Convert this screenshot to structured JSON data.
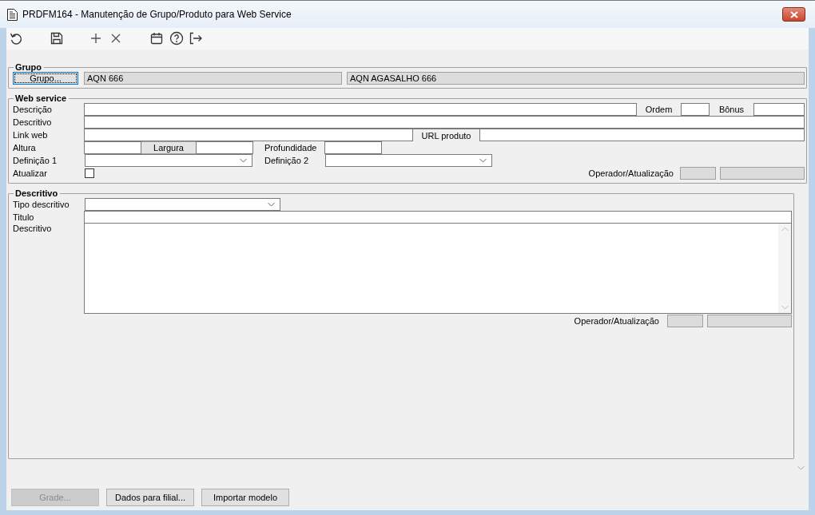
{
  "window": {
    "title": "PRDFM164 - Manutenção de Grupo/Produto para Web Service"
  },
  "grupo": {
    "title": "Grupo",
    "button": "Grupo...",
    "code": "AQN 666",
    "name": "AQN AGASALHO 666"
  },
  "web_service": {
    "title": "Web service",
    "descricao_label": "Descrição",
    "ordem_label": "Ordem",
    "bonus_label": "Bônus",
    "descritivo_label": "Descritivo",
    "link_web_label": "Link web",
    "url_produto_label": "URL produto",
    "altura_label": "Altura",
    "largura_label": "Largura",
    "profundidade_label": "Profundidade",
    "definicao1_label": "Definição 1",
    "definicao2_label": "Definição 2",
    "atualizar_label": "Atualizar",
    "atualizar_checked": false,
    "operador_label": "Operador/Atualização"
  },
  "descritivo": {
    "title": "Descritivo",
    "tipo_label": "Tipo descritivo",
    "titulo_label": "Titulo",
    "descritivo_label": "Descritivo",
    "operador_label": "Operador/Atualização"
  },
  "buttons": [
    {
      "label": "Grade...",
      "disabled": true
    },
    {
      "label": "Dados para filial...",
      "disabled": false
    },
    {
      "label": "Importar modelo",
      "disabled": false
    }
  ]
}
